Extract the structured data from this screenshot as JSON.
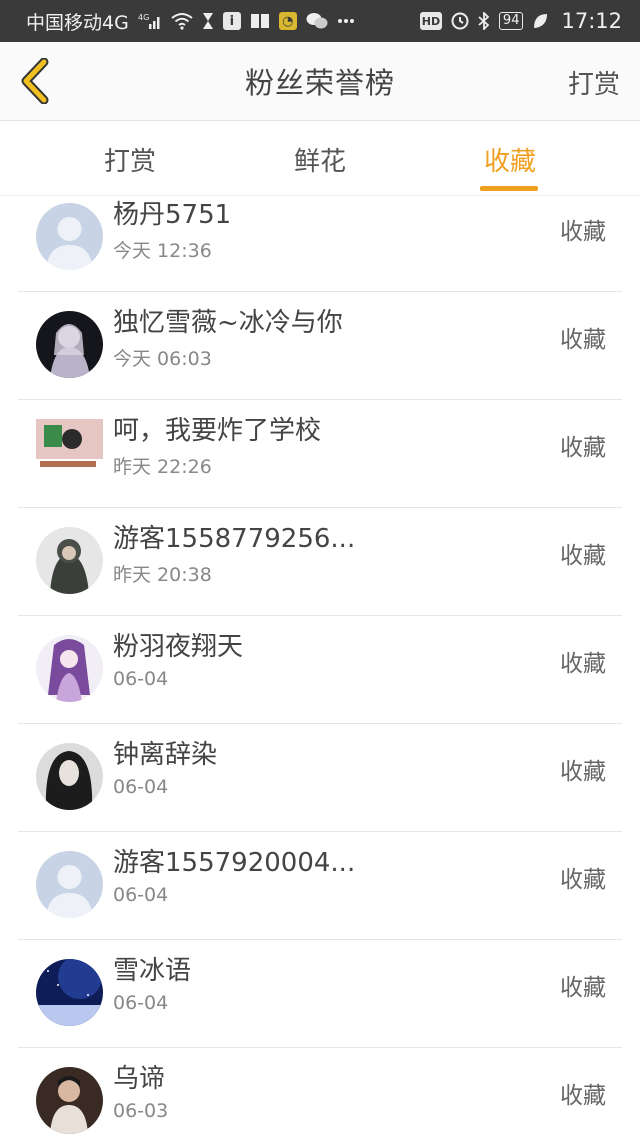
{
  "status_bar": {
    "carrier": "中国移动4G",
    "net_badge": "4G",
    "battery": "94",
    "time": "17:12",
    "icons": [
      "signal-icon",
      "wifi-icon",
      "hourglass-icon",
      "info-icon",
      "book-icon",
      "chat-app-icon",
      "wechat-icon",
      "more-icon",
      "hd-icon",
      "alarm-icon",
      "bluetooth-icon",
      "battery-icon",
      "leaf-icon"
    ]
  },
  "header": {
    "title": "粉丝荣誉榜",
    "action": "打赏",
    "back_icon": "chevron-left-icon"
  },
  "tabs": [
    {
      "label": "打赏",
      "active": false
    },
    {
      "label": "鲜花",
      "active": false
    },
    {
      "label": "收藏",
      "active": true
    }
  ],
  "accent_color": "#f0a020",
  "list": [
    {
      "name": "杨丹5751",
      "time": "今天 12:36",
      "action": "收藏",
      "avatar": "default-avatar"
    },
    {
      "name": "独忆雪薇~冰冷与你",
      "time": "今天 06:03",
      "action": "收藏",
      "avatar": "anime-girl-avatar"
    },
    {
      "name": "呵，我要炸了学校",
      "time": "昨天 22:26",
      "action": "收藏",
      "avatar": "anime-art-avatar"
    },
    {
      "name": "游客1558779256...",
      "time": "昨天 20:38",
      "action": "收藏",
      "avatar": "hoodie-avatar"
    },
    {
      "name": "粉羽夜翔天",
      "time": "06-04",
      "action": "收藏",
      "avatar": "purple-anime-avatar"
    },
    {
      "name": "钟离辞染",
      "time": "06-04",
      "action": "收藏",
      "avatar": "dark-hair-avatar"
    },
    {
      "name": "游客1557920004...",
      "time": "06-04",
      "action": "收藏",
      "avatar": "default-avatar"
    },
    {
      "name": "雪冰语",
      "time": "06-04",
      "action": "收藏",
      "avatar": "night-sky-avatar"
    },
    {
      "name": "乌谛",
      "time": "06-03",
      "action": "收藏",
      "avatar": "person-avatar"
    }
  ]
}
